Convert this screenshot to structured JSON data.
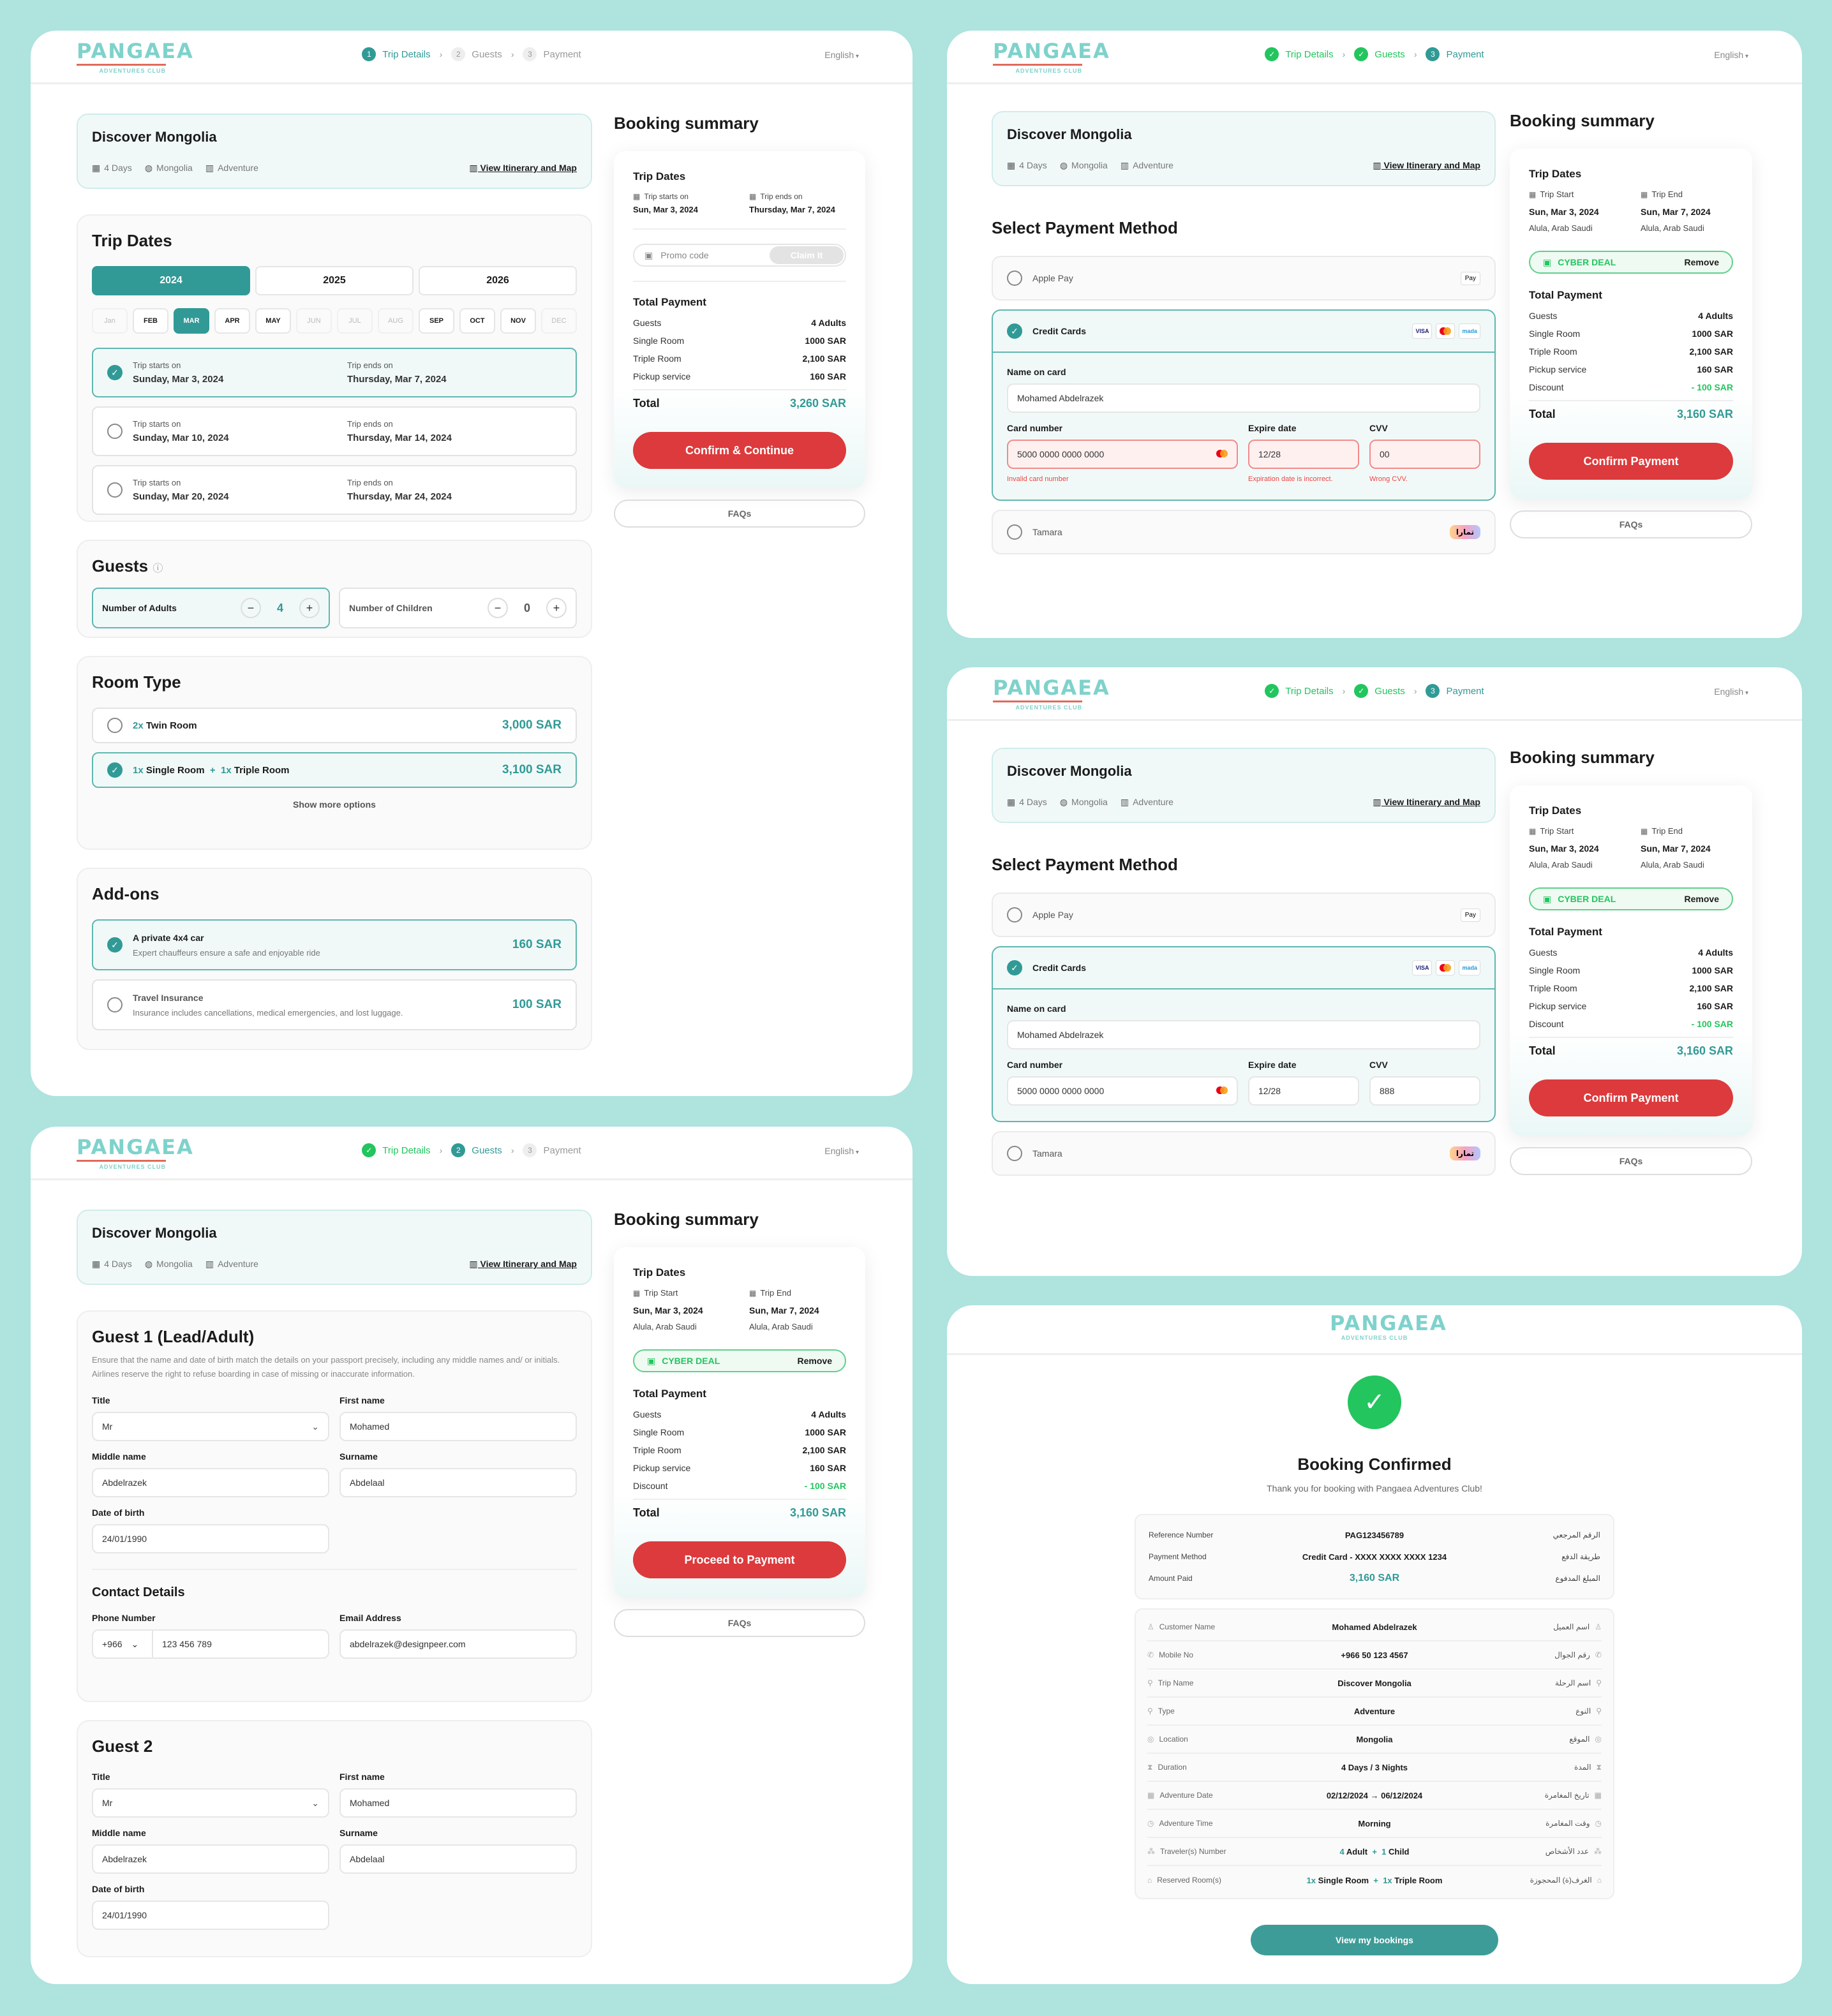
{
  "brand": {
    "name": "PANGAEA",
    "tagline": "ADVENTURES CLUB",
    "accent": "#319a96",
    "cta_color": "#dc3a3c",
    "success": "#22c55e",
    "background": "#aee3de"
  },
  "nav": {
    "steps": [
      "Trip Details",
      "Guests",
      "Payment"
    ],
    "step_numbers": [
      "1",
      "2",
      "3"
    ],
    "language": "English"
  },
  "trip": {
    "name": "Discover Mongolia",
    "duration": "4 Days",
    "location": "Mongolia",
    "type": "Adventure",
    "itinerary_link": "View Itinerary and Map"
  },
  "trip_details_screen": {
    "trip_dates": {
      "title": "Trip Dates",
      "years": [
        {
          "label": "2024",
          "selected": true
        },
        {
          "label": "2025",
          "selected": false
        },
        {
          "label": "2026",
          "selected": false
        }
      ],
      "months": [
        {
          "label": "Jan",
          "state": "disabled"
        },
        {
          "label": "FEB",
          "state": "enabled"
        },
        {
          "label": "MAR",
          "state": "selected"
        },
        {
          "label": "APR",
          "state": "enabled"
        },
        {
          "label": "MAY",
          "state": "enabled"
        },
        {
          "label": "JUN",
          "state": "disabled"
        },
        {
          "label": "JUL",
          "state": "disabled"
        },
        {
          "label": "AUG",
          "state": "disabled"
        },
        {
          "label": "SEP",
          "state": "enabled"
        },
        {
          "label": "OCT",
          "state": "enabled"
        },
        {
          "label": "NOV",
          "state": "enabled"
        },
        {
          "label": "DEC",
          "state": "disabled"
        }
      ],
      "start_label": "Trip starts on",
      "end_label": "Trip ends on",
      "options": [
        {
          "start": "Sunday, Mar 3, 2024",
          "end": "Thursday, Mar 7, 2024",
          "selected": true
        },
        {
          "start": "Sunday, Mar 10, 2024",
          "end": "Thursday, Mar 14, 2024",
          "selected": false
        },
        {
          "start": "Sunday, Mar 20, 2024",
          "end": "Thursday, Mar 24, 2024",
          "selected": false
        }
      ]
    },
    "guests": {
      "title": "Guests",
      "adults_label": "Number of Adults",
      "adults": "4",
      "children_label": "Number of Children",
      "children": "0"
    },
    "room_type": {
      "title": "Room Type",
      "options": [
        {
          "qty1": "2x",
          "room1": "Twin Room",
          "plus": "",
          "qty2": "",
          "room2": "",
          "price": "3,000 SAR",
          "selected": false
        },
        {
          "qty1": "1x",
          "room1": "Single Room",
          "plus": "+",
          "qty2": "1x",
          "room2": "Triple Room",
          "price": "3,100 SAR",
          "selected": true
        }
      ],
      "show_more": "Show more options"
    },
    "addons": {
      "title": "Add-ons",
      "items": [
        {
          "title": "A private 4x4 car",
          "desc": "Expert chauffeurs ensure a safe and enjoyable ride",
          "price": "160 SAR",
          "selected": true
        },
        {
          "title": "Travel Insurance",
          "desc": "Insurance includes cancellations, medical emergencies, and lost luggage.",
          "price": "100 SAR",
          "selected": false
        }
      ]
    },
    "summary": {
      "title": "Booking summary",
      "trip_dates_title": "Trip Dates",
      "start_label": "Trip starts on",
      "start": "Sun, Mar 3, 2024",
      "end_label": "Trip ends on",
      "end": "Thursday, Mar 7, 2024",
      "promo_placeholder": "Promo code",
      "claim": "Claim It",
      "total_payment_title": "Total Payment",
      "rows": [
        {
          "label": "Guests",
          "value": "4 Adults"
        },
        {
          "label": "Single Room",
          "value": "1000 SAR"
        },
        {
          "label": "Triple Room",
          "value": "2,100 SAR"
        },
        {
          "label": "Pickup service",
          "value": "160 SAR"
        }
      ],
      "total_label": "Total",
      "total": "3,260 SAR",
      "cta": "Confirm & Continue",
      "faqs": "FAQs"
    }
  },
  "summary_with_deal": {
    "title": "Booking summary",
    "trip_dates_title": "Trip Dates",
    "start_label": "Trip Start",
    "start": "Sun, Mar 3, 2024",
    "start_loc": "Alula, Arab Saudi",
    "end_label": "Trip End",
    "end": "Sun, Mar 7, 2024",
    "end_loc": "Alula, Arab Saudi",
    "deal_code": "CYBER DEAL",
    "deal_remove": "Remove",
    "total_payment_title": "Total Payment",
    "rows": [
      {
        "label": "Guests",
        "value": "4 Adults"
      },
      {
        "label": "Single Room",
        "value": "1000 SAR"
      },
      {
        "label": "Triple Room",
        "value": "2,100 SAR"
      },
      {
        "label": "Pickup service",
        "value": "160 SAR"
      },
      {
        "label": "Discount",
        "value": "- 100 SAR"
      }
    ],
    "total_label": "Total",
    "total": "3,160 SAR",
    "cta_guests": "Proceed to Payment",
    "cta_payment": "Confirm Payment",
    "faqs": "FAQs"
  },
  "guests_screen": {
    "guest1": {
      "title": "Guest 1 (Lead/Adult)",
      "note": "Ensure that the name and date of birth match the details on your passport precisely, including any middle names and/ or initials. Airlines reserve the right to refuse boarding in case of missing or inaccurate information.",
      "title_label": "Title",
      "title_value": "Mr",
      "first_label": "First name",
      "first": "Mohamed",
      "middle_label": "Middle name",
      "middle": "Abdelrazek",
      "surname_label": "Surname",
      "surname": "Abdelaal",
      "dob_label": "Date of birth",
      "dob": "24/01/1990"
    },
    "contact": {
      "title": "Contact Details",
      "phone_label": "Phone Number",
      "country_code": "+966",
      "phone": "123 456 789",
      "email_label": "Email Address",
      "email": "abdelrazek@designpeer.com"
    },
    "guest2": {
      "title": "Guest 2",
      "title_label": "Title",
      "title_value": "Mr",
      "first_label": "First name",
      "first": "Mohamed",
      "middle_label": "Middle name",
      "middle": "Abdelrazek",
      "surname_label": "Surname",
      "surname": "Abdelaal",
      "dob_label": "Date of birth",
      "dob": "24/01/1990"
    }
  },
  "payment_screen": {
    "title": "Select Payment Method",
    "apple_pay": "Apple Pay",
    "apple_badge": "Pay",
    "credit_cards": "Credit Cards",
    "card_badges": [
      "VISA",
      "mastercard",
      "mada"
    ],
    "name_label": "Name on card",
    "name": "Mohamed Abdelrazek",
    "number_label": "Card number",
    "number": "5000 0000 0000 0000",
    "expiry_label": "Expire date",
    "expiry": "12/28",
    "cvv_label": "CVV",
    "tamara": "Tamara",
    "tamara_badge": "تمارا",
    "error_state": {
      "cvv": "00",
      "number_error": "Invalid card number",
      "expiry_error": "Expiration date is incorrect.",
      "cvv_error": "Wrong CVV."
    },
    "valid_state": {
      "cvv": "888"
    }
  },
  "confirmation": {
    "title": "Booking Confirmed",
    "subtitle": "Thank you for booking with Pangaea Adventures Club!",
    "reference": [
      {
        "en": "Reference Number",
        "value": "PAG123456789",
        "ar": "الرقم المرجعي"
      },
      {
        "en": "Payment Method",
        "value": "Credit Card - XXXX XXXX XXXX 1234",
        "ar": "طريقة الدفع"
      },
      {
        "en": "Amount Paid",
        "value": "3,160 SAR",
        "ar": "المبلغ المدفوع"
      }
    ],
    "details": [
      {
        "icon": "user-icon",
        "en": "Customer Name",
        "value": "Mohamed Abdelrazek",
        "ar": "اسم العميل"
      },
      {
        "icon": "phone-icon",
        "en": "Mobile No",
        "value": "+966 50 123 4567",
        "ar": "رقم الجوال"
      },
      {
        "icon": "trip-icon",
        "en": "Trip Name",
        "value": "Discover Mongolia",
        "ar": "اسم الرحلة"
      },
      {
        "icon": "type-icon",
        "en": "Type",
        "value": "Adventure",
        "ar": "النوع"
      },
      {
        "icon": "location-icon",
        "en": "Location",
        "value": "Mongolia",
        "ar": "الموقع"
      },
      {
        "icon": "hourglass-icon",
        "en": "Duration",
        "value": "4 Days / 3 Nights",
        "ar": "المدة"
      },
      {
        "icon": "calendar-icon",
        "en": "Adventure Date",
        "value": "02/12/2024 → 06/12/2024",
        "ar": "تاريخ المغامرة"
      },
      {
        "icon": "clock-icon",
        "en": "Adventure Time",
        "value": "Morning",
        "ar": "وقت المغامرة"
      },
      {
        "icon": "people-icon",
        "en": "Traveler(s) Number",
        "value": "",
        "ar": "عدد الأشخاص"
      },
      {
        "icon": "room-icon",
        "en": "Reserved Room(s)",
        "value": "",
        "ar": "الغرف(ة) المحجوزة"
      }
    ],
    "travelers": {
      "adults_n": "4",
      "adults": "Adult",
      "plus": "+",
      "children_n": "1",
      "children": "Child"
    },
    "rooms": {
      "q1": "1x",
      "r1": "Single Room",
      "plus": "+",
      "q2": "1x",
      "r2": "Triple Room"
    },
    "cta": "View my bookings"
  }
}
